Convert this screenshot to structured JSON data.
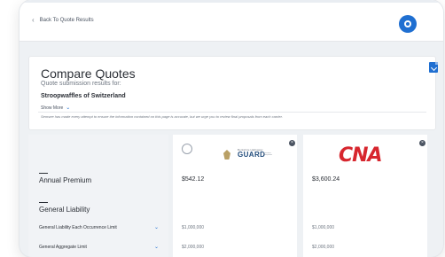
{
  "nav": {
    "back_label": "Back To Quote Results"
  },
  "header": {
    "title": "Compare Quotes",
    "subtitle": "Quote submission results for:",
    "company": "Stroopwaffles of Switzerland",
    "show_more": "Show More",
    "disclaimer": "Semsee has made every attempt to ensure the information contained on this page is accurate, but we urge you to review final proposals from each carrier."
  },
  "carriers": [
    {
      "name": "GUARD",
      "tagline_top": "Berkshire Hathaway",
      "tagline": "Insurance Companies"
    },
    {
      "name": "CNA"
    }
  ],
  "rows": {
    "annual_premium": {
      "label": "Annual Premium",
      "values": [
        "$542.12",
        "$3,600.24"
      ]
    },
    "general_liability": {
      "label": "General Liability"
    },
    "each_occurrence": {
      "label": "General Liability Each Occurrence Limit",
      "values": [
        "$1,000,000",
        "$1,000,000"
      ]
    },
    "aggregate": {
      "label": "General Aggregate Limit",
      "values": [
        "$2,000,000",
        "$2,000,000"
      ]
    }
  },
  "colors": {
    "accent": "#1f6fd1",
    "cna_red": "#d7262e"
  },
  "icons": [
    "chevron-left-icon",
    "help-icon",
    "pdf-download-icon",
    "chevron-down-icon",
    "close-icon"
  ]
}
